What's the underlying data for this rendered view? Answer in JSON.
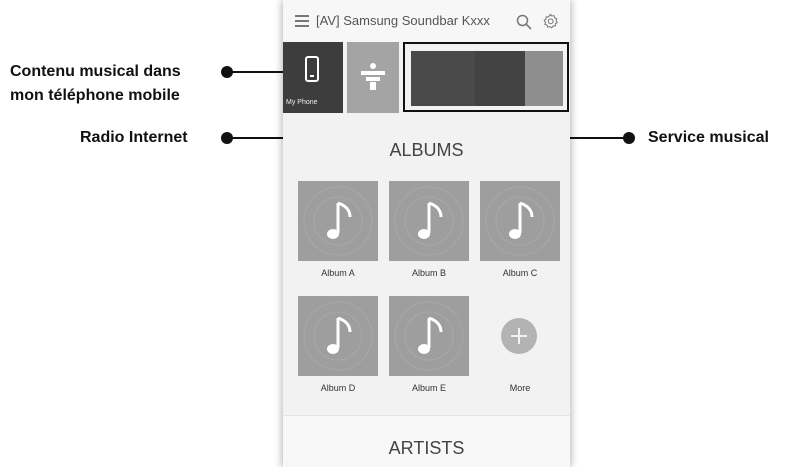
{
  "callouts": {
    "phone_line1": "Contenu musical dans",
    "phone_line2": "mon téléphone mobile",
    "radio": "Radio Internet",
    "service": "Service musical"
  },
  "app": {
    "title": "[AV] Samsung Soundbar Kxxx"
  },
  "sources": {
    "phone_label": "My Phone",
    "icons": [
      "phone-icon",
      "tunein-icon"
    ]
  },
  "sections": {
    "albums": "ALBUMS",
    "artists": "ARTISTS"
  },
  "albums": [
    {
      "name": "Album A"
    },
    {
      "name": "Album B"
    },
    {
      "name": "Album C"
    },
    {
      "name": "Album D"
    },
    {
      "name": "Album E"
    }
  ],
  "more_label": "More",
  "colors": {
    "phone_tile": "#3d3d3d",
    "radio_tile": "#a4a4a4",
    "album_cover": "#9e9e9e",
    "callout": "#111111"
  }
}
